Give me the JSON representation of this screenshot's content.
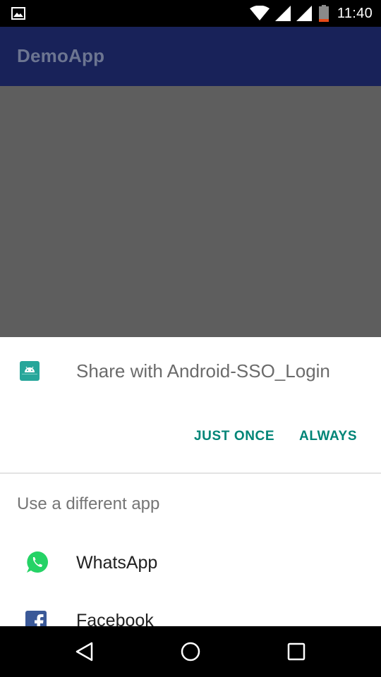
{
  "status_bar": {
    "time": "11:40",
    "icons": [
      "image-notification-icon",
      "wifi-icon",
      "signal-icon",
      "signal-icon",
      "battery-icon"
    ]
  },
  "app_bar": {
    "title": "DemoApp"
  },
  "share_sheet": {
    "title": "Share with Android-SSO_Login",
    "app_icon": "android-app-icon",
    "buttons": {
      "just_once": "JUST ONCE",
      "always": "ALWAYS"
    },
    "section_label": "Use a different app",
    "apps": [
      {
        "label": "WhatsApp",
        "icon": "whatsapp-icon"
      },
      {
        "label": "Facebook",
        "icon": "facebook-icon"
      }
    ]
  },
  "nav_bar": {
    "icons": [
      "back-icon",
      "home-icon",
      "recents-icon"
    ]
  },
  "colors": {
    "accent": "#008577",
    "app_bar": "#182259",
    "scrim": "#5e5e5e",
    "android_icon": "#27a69a",
    "whatsapp": "#25d366",
    "facebook": "#3b5998"
  }
}
